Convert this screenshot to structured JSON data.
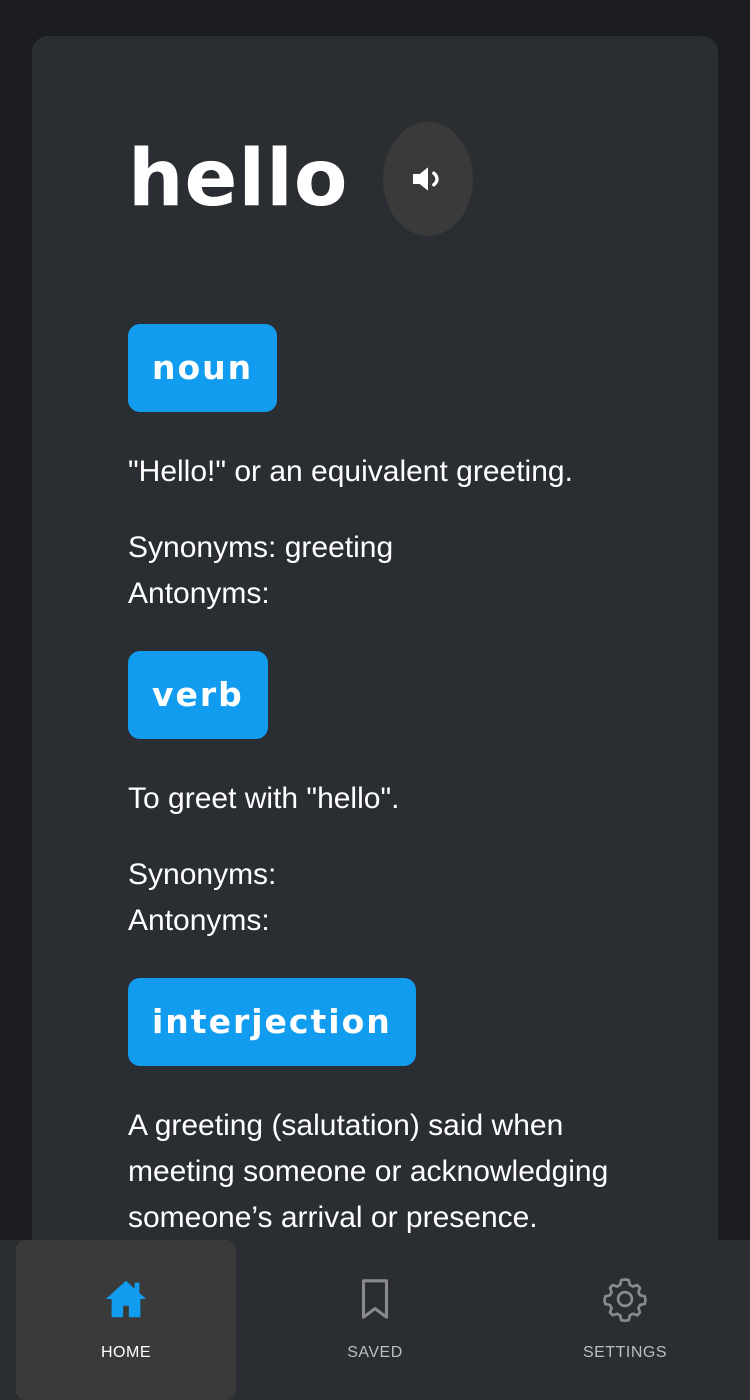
{
  "entry": {
    "word": "hello",
    "speak_icon": "speaker-icon"
  },
  "meanings": [
    {
      "part_of_speech": "noun",
      "definition": "\"Hello!\" or an equivalent greeting.",
      "synonyms_label": "Synonyms: greeting",
      "antonyms_label": "Antonyms:"
    },
    {
      "part_of_speech": "verb",
      "definition": "To greet with \"hello\".",
      "synonyms_label": "Synonyms:",
      "antonyms_label": "Antonyms:"
    },
    {
      "part_of_speech": "interjection",
      "definition": "A greeting (salutation) said when meeting someone or acknowledging someone’s arrival or presence."
    }
  ],
  "nav": {
    "items": [
      {
        "label": "HOME",
        "icon": "home-icon",
        "active": true
      },
      {
        "label": "SAVED",
        "icon": "bookmark-icon",
        "active": false
      },
      {
        "label": "SETTINGS",
        "icon": "gear-icon",
        "active": false
      }
    ]
  },
  "colors": {
    "accent": "#129cf0",
    "background": "#1b1d20",
    "card": "#2a2e33"
  }
}
